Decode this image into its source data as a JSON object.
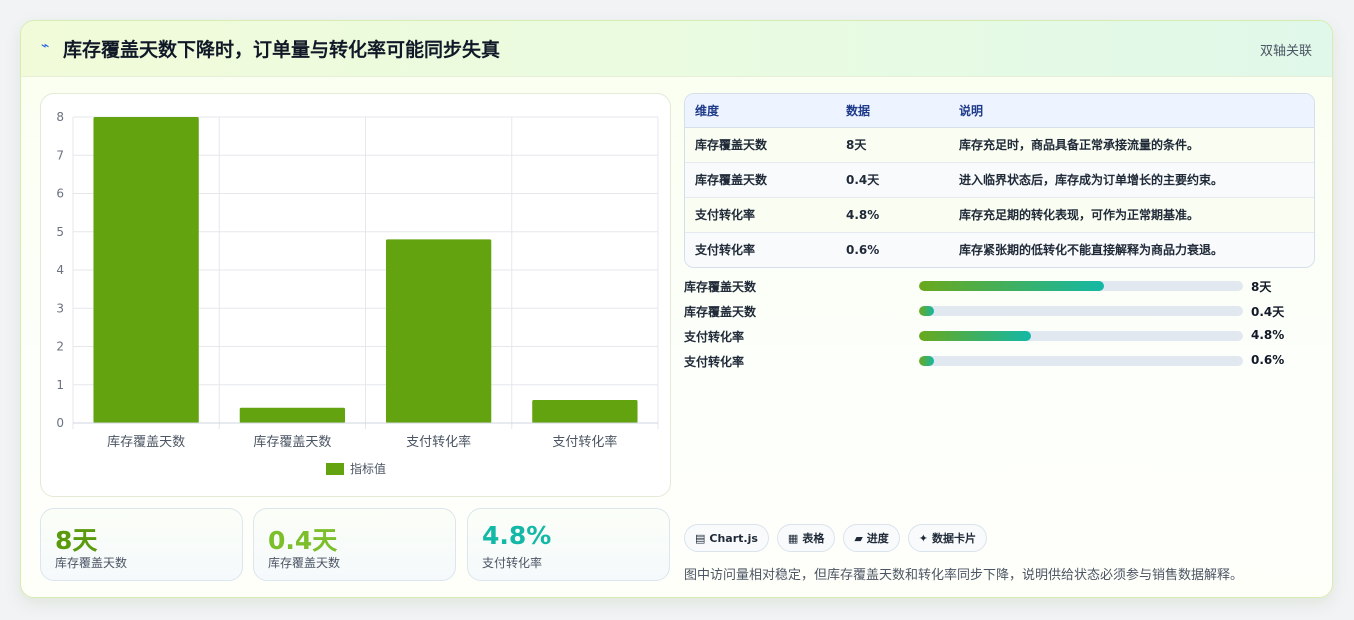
{
  "header": {
    "icon": "sparkline-icon",
    "title": "库存覆盖天数下降时，订单量与转化率可能同步失真",
    "tag": "双轴关联"
  },
  "chart_data": {
    "type": "bar",
    "categories": [
      "库存覆盖天数",
      "库存覆盖天数",
      "支付转化率",
      "支付转化率"
    ],
    "values": [
      8,
      0.4,
      4.8,
      0.6
    ],
    "ylim": [
      0,
      8
    ],
    "yticks": [
      0,
      1,
      2,
      3,
      4,
      5,
      6,
      7,
      8
    ],
    "series": [
      {
        "name": "指标值",
        "values": [
          8,
          0.4,
          4.8,
          0.6
        ],
        "color": "#62a30f"
      }
    ],
    "grid": true,
    "legend": "bottom"
  },
  "kpis": [
    {
      "value": "8天",
      "label": "库存覆盖天数",
      "color": "#5a9a0c"
    },
    {
      "value": "0.4天",
      "label": "库存覆盖天数",
      "color": "#7cbf2a"
    },
    {
      "value": "4.8%",
      "label": "支付转化率",
      "color": "#14b8a6"
    }
  ],
  "table": {
    "headers": [
      "维度",
      "数据",
      "说明"
    ],
    "rows": [
      [
        "库存覆盖天数",
        "8天",
        "库存充足时，商品具备正常承接流量的条件。"
      ],
      [
        "库存覆盖天数",
        "0.4天",
        "进入临界状态后，库存成为订单增长的主要约束。"
      ],
      [
        "支付转化率",
        "4.8%",
        "库存充足期的转化表现，可作为正常期基准。"
      ],
      [
        "支付转化率",
        "0.6%",
        "库存紧张期的低转化不能直接解释为商品力衰退。"
      ]
    ]
  },
  "progress": [
    {
      "label": "库存覆盖天数",
      "value": "8天",
      "fraction": 0.57
    },
    {
      "label": "库存覆盖天数",
      "value": "0.4天",
      "fraction": 0.045
    },
    {
      "label": "支付转化率",
      "value": "4.8%",
      "fraction": 0.345
    },
    {
      "label": "支付转化率",
      "value": "0.6%",
      "fraction": 0.045
    }
  ],
  "chips": [
    {
      "icon": "chart-icon",
      "glyph": "▤",
      "label": "Chart.js"
    },
    {
      "icon": "table-icon",
      "glyph": "▦",
      "label": "表格"
    },
    {
      "icon": "progress-icon",
      "glyph": "▰",
      "label": "进度"
    },
    {
      "icon": "sparkle-icon",
      "glyph": "✦",
      "label": "数据卡片"
    }
  ],
  "note": "图中访问量相对稳定，但库存覆盖天数和转化率同步下降，说明供给状态必须参与销售数据解释。"
}
